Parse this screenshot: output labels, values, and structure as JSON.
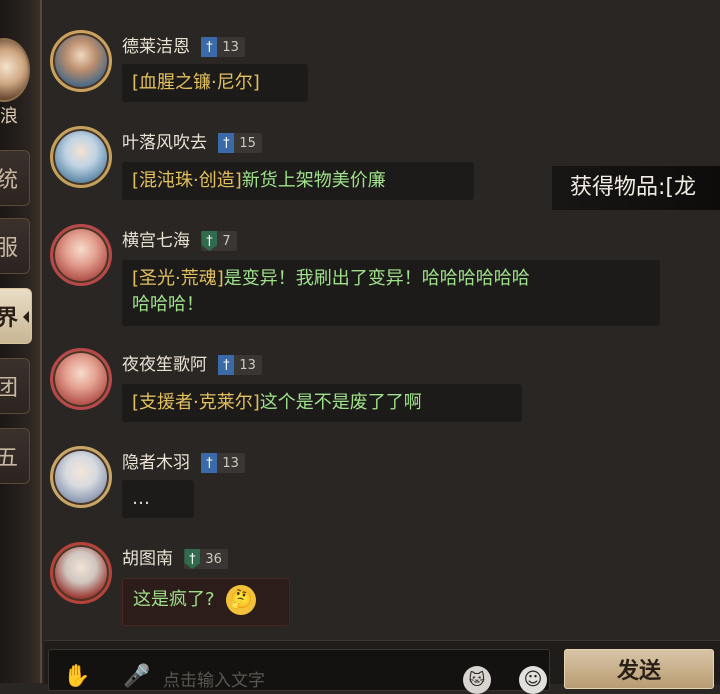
{
  "left_rail": {
    "player_name": "浪",
    "tabs": [
      {
        "label": "统",
        "active": false
      },
      {
        "label": "服",
        "active": false
      },
      {
        "label": "界",
        "active": true
      },
      {
        "label": "团",
        "active": false
      },
      {
        "label": "五",
        "active": false
      }
    ]
  },
  "messages": [
    {
      "name": "德莱洁恩",
      "badge": {
        "type": "blue",
        "level": "13"
      },
      "segments": [
        {
          "text": "[血腥之镰·尼尔]",
          "color": "gold"
        }
      ]
    },
    {
      "name": "叶落风吹去",
      "badge": {
        "type": "blue",
        "level": "15"
      },
      "segments": [
        {
          "text": "[混沌珠·创造]",
          "color": "gold"
        },
        {
          "text": "新货上架物美价廉",
          "color": "green"
        }
      ]
    },
    {
      "name": "横宫七海",
      "badge": {
        "type": "green",
        "level": "7"
      },
      "segments": [
        {
          "text": "[圣光·荒魂]",
          "color": "gold"
        },
        {
          "text": "是变异！我刷出了变异！哈哈哈哈哈哈",
          "color": "green"
        },
        {
          "text": "哈哈哈！",
          "color": "green"
        }
      ]
    },
    {
      "name": "夜夜笙歌阿",
      "badge": {
        "type": "blue",
        "level": "13"
      },
      "segments": [
        {
          "text": "[支援者·克莱尔]",
          "color": "gold"
        },
        {
          "text": "这个是不是废了了啊",
          "color": "green"
        }
      ]
    },
    {
      "name": "隐者木羽",
      "badge": {
        "type": "blue",
        "level": "13"
      },
      "segments": [
        {
          "text": "…",
          "color": "white"
        }
      ]
    },
    {
      "name": "胡图南",
      "badge": {
        "type": "green",
        "level": "36"
      },
      "segments": [
        {
          "text": "这是疯了?",
          "color": "green"
        }
      ],
      "emoji": "🤔"
    }
  ],
  "notice": {
    "text": "获得物品:[龙"
  },
  "input": {
    "placeholder": "点击输入文字",
    "send_label": "发送"
  },
  "colors": {
    "gold_text": "#e2c05e",
    "green_text": "#9fe08a",
    "background": "#2a2624"
  }
}
